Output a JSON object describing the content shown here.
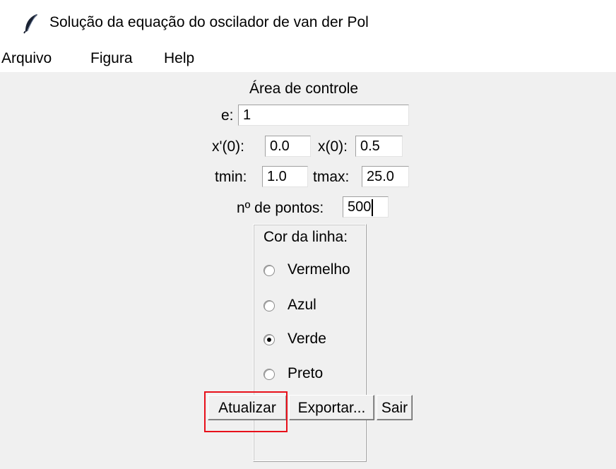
{
  "window": {
    "title": "Solução da equação do oscilador de van der Pol",
    "icon": "feather-icon"
  },
  "menubar": {
    "items": [
      "Arquivo",
      "Figura",
      "Help"
    ]
  },
  "control": {
    "heading": "Área de controle",
    "e_label": "e:",
    "e_value": "1",
    "xp0_label": "x'(0):",
    "xp0_value": "0.0",
    "x0_label": "x(0):",
    "x0_value": "0.5",
    "tmin_label": "tmin:",
    "tmin_value": "1.0",
    "tmax_label": "tmax:",
    "tmax_value": "25.0",
    "npontos_label": "nº de pontos:",
    "npontos_value": "500"
  },
  "line_color": {
    "title": "Cor da linha:",
    "options": [
      {
        "label": "Vermelho",
        "selected": false
      },
      {
        "label": "Azul",
        "selected": false
      },
      {
        "label": "Verde",
        "selected": true
      },
      {
        "label": "Preto",
        "selected": false
      }
    ]
  },
  "buttons": {
    "update": "Atualizar",
    "export": "Exportar...",
    "exit": "Sair"
  },
  "colors": {
    "highlight": "#e8101a",
    "background": "#f0f0f0"
  }
}
